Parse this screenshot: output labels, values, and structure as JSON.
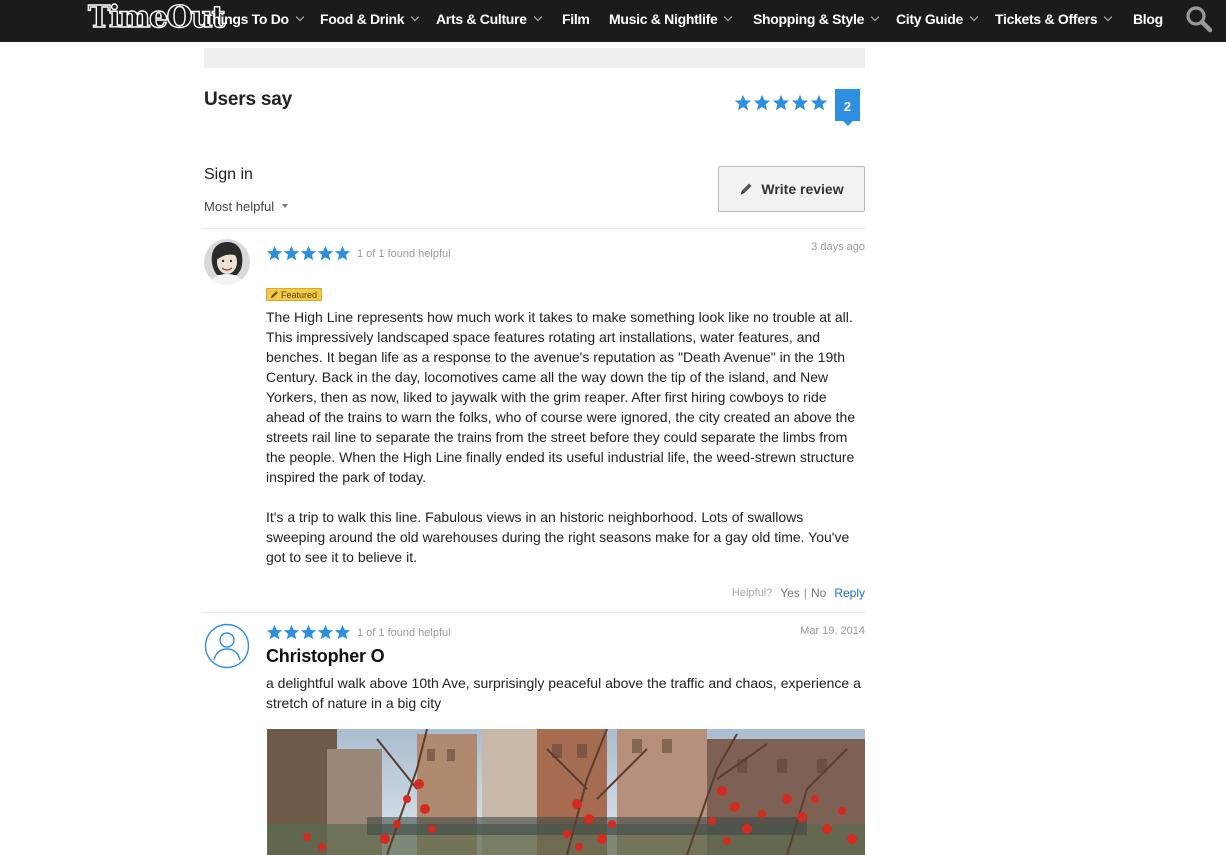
{
  "nav": {
    "logo": "TimeOut",
    "items": [
      {
        "label": "Things To Do",
        "dropdown": true
      },
      {
        "label": "Food & Drink",
        "dropdown": true
      },
      {
        "label": "Arts & Culture",
        "dropdown": true
      },
      {
        "label": "Film",
        "dropdown": false
      },
      {
        "label": "Music & Nightlife",
        "dropdown": true
      },
      {
        "label": "Shopping & Style",
        "dropdown": true
      },
      {
        "label": "City Guide",
        "dropdown": true
      },
      {
        "label": "Tickets & Offers",
        "dropdown": true
      },
      {
        "label": "Blog",
        "dropdown": false
      }
    ],
    "search_icon": "search-icon"
  },
  "reviews_section": {
    "heading": "Users say",
    "overall_rating": 5,
    "max_rating": 5,
    "review_count": "2",
    "sign_in": "Sign in",
    "sort_label": "Most helpful",
    "write_review": "Write review"
  },
  "reviews": [
    {
      "rating": 5,
      "helpful_count": "1 of 1 found helpful",
      "date": "3 days ago",
      "featured_label": "Featured",
      "avatar": "user-photo",
      "paragraphs": [
        "The High Line represents how much work it takes to make something look like no trouble at all.  This impressively landscaped space features rotating art installations, water features, and benches.  It began life as a response to the avenue's reputation as \"Death Avenue\" in the 19th Century.  Back in the day, locomotives came all the way down the tip of the island, and New Yorkers, then as now, liked to jaywalk with the grim reaper.  After first hiring cowboys to ride ahead of the trains to warn the folks, who of course were ignored, the city created an above the streets rail line to separate the trains from the street before they could separate the limbs from the people.  When the High Line finally ended its useful industrial life, the weed-strewn structure inspired the park of today.",
        "It's a trip to walk this line.  Fabulous views in an historic neighborhood.  Lots of swallows sweeping around the old warehouses during the right seasons make for a gay old time.  You've got to see it to believe it."
      ],
      "helpful_prompt": "Helpful?",
      "yes": "Yes",
      "separator": "|",
      "no": "No",
      "reply": "Reply"
    },
    {
      "rating": 5,
      "helpful_count": "1 of 1 found helpful",
      "date": "Mar 19, 2014",
      "avatar": "default-user-icon",
      "name": "Christopher O",
      "paragraphs": [
        "a delightful walk above 10th Ave, surprisingly peaceful above the traffic and chaos, experience a stretch of nature in a big city"
      ],
      "photo": "review-photo"
    }
  ],
  "colors": {
    "nav_bg": "#1b1b1b",
    "star_blue": "#2e8fe0",
    "badge_blue": "#2e8fe0",
    "featured_yellow": "#f3c94a",
    "reply_link": "#1d6fb8"
  }
}
